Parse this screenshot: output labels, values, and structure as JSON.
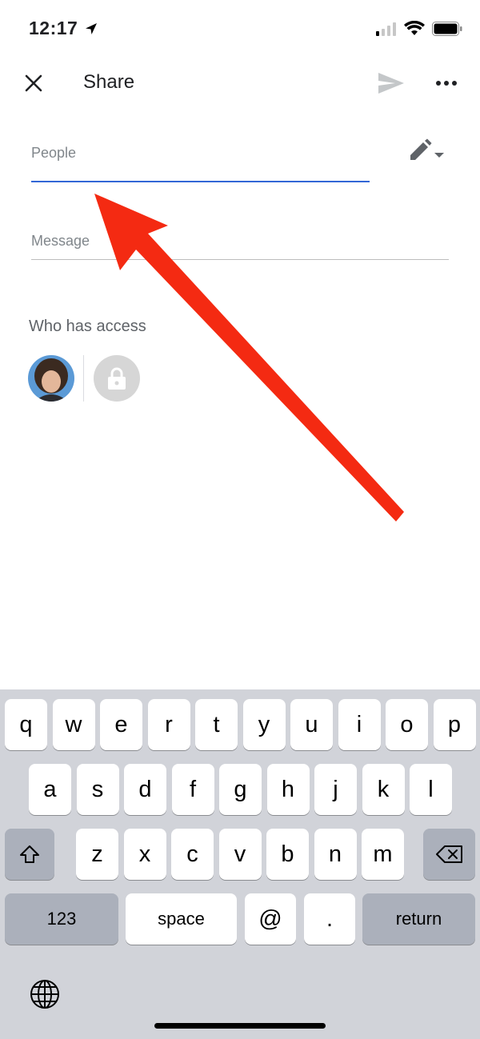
{
  "status": {
    "time": "12:17"
  },
  "header": {
    "title": "Share"
  },
  "form": {
    "people_placeholder": "People",
    "message_placeholder": "Message"
  },
  "access": {
    "title": "Who has access"
  },
  "keyboard": {
    "row1": [
      "q",
      "w",
      "e",
      "r",
      "t",
      "y",
      "u",
      "i",
      "o",
      "p"
    ],
    "row2": [
      "a",
      "s",
      "d",
      "f",
      "g",
      "h",
      "j",
      "k",
      "l"
    ],
    "row3": [
      "z",
      "x",
      "c",
      "v",
      "b",
      "n",
      "m"
    ],
    "numbers_label": "123",
    "space_label": "space",
    "at_label": "@",
    "period_label": ".",
    "return_label": "return"
  },
  "colors": {
    "accent": "#3367d6",
    "arrow": "#f42a12",
    "keyboard_bg": "#d1d3d9"
  }
}
